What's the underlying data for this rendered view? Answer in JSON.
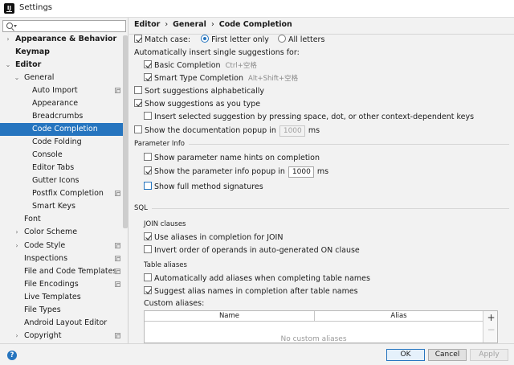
{
  "window": {
    "title": "Settings",
    "app_icon_glyph": "IJ"
  },
  "search": {
    "placeholder": "",
    "value": ""
  },
  "sidebar": {
    "items": [
      {
        "label": "Appearance & Behavior",
        "expander": "›"
      },
      {
        "label": "Keymap",
        "expander": ""
      },
      {
        "label": "Editor",
        "expander": "⌄"
      },
      {
        "label": "General",
        "expander": "⌄"
      },
      {
        "label": "Auto Import",
        "expander": ""
      },
      {
        "label": "Appearance",
        "expander": ""
      },
      {
        "label": "Breadcrumbs",
        "expander": ""
      },
      {
        "label": "Code Completion",
        "expander": ""
      },
      {
        "label": "Code Folding",
        "expander": ""
      },
      {
        "label": "Console",
        "expander": ""
      },
      {
        "label": "Editor Tabs",
        "expander": ""
      },
      {
        "label": "Gutter Icons",
        "expander": ""
      },
      {
        "label": "Postfix Completion",
        "expander": ""
      },
      {
        "label": "Smart Keys",
        "expander": ""
      },
      {
        "label": "Font",
        "expander": ""
      },
      {
        "label": "Color Scheme",
        "expander": "›"
      },
      {
        "label": "Code Style",
        "expander": "›"
      },
      {
        "label": "Inspections",
        "expander": ""
      },
      {
        "label": "File and Code Templates",
        "expander": ""
      },
      {
        "label": "File Encodings",
        "expander": ""
      },
      {
        "label": "Live Templates",
        "expander": ""
      },
      {
        "label": "File Types",
        "expander": ""
      },
      {
        "label": "Android Layout Editor",
        "expander": ""
      },
      {
        "label": "Copyright",
        "expander": "›"
      }
    ],
    "selected": "Code Completion"
  },
  "breadcrumb": {
    "part1": "Editor",
    "part2": "General",
    "part3": "Code Completion",
    "separator": "›"
  },
  "completion": {
    "match_case": "Match case:",
    "first_letter_only": "First letter only",
    "all_letters": "All letters",
    "auto_insert_title": "Automatically insert single suggestions for:",
    "basic_completion": "Basic Completion",
    "basic_shortcut": "Ctrl+空格",
    "smart_type_completion": "Smart Type Completion",
    "smart_shortcut": "Alt+Shift+空格",
    "sort_alpha": "Sort suggestions alphabetically",
    "show_as_you_type": "Show suggestions as you type",
    "insert_selected": "Insert selected suggestion by pressing space, dot, or other context-dependent keys",
    "doc_popup": "Show the documentation popup in",
    "doc_popup_value": "1000",
    "doc_popup_unit": "ms"
  },
  "parameter_info": {
    "title": "Parameter Info",
    "name_hints": "Show parameter name hints on completion",
    "info_popup": "Show the parameter info popup in",
    "info_popup_value": "1000",
    "info_popup_unit": "ms",
    "full_signatures": "Show full method signatures"
  },
  "sql": {
    "title": "SQL",
    "join_title": "JOIN clauses",
    "use_aliases": "Use aliases in completion for JOIN",
    "invert_order": "Invert order of operands in auto-generated ON clause",
    "table_aliases_title": "Table aliases",
    "auto_add": "Automatically add aliases when completing table names",
    "suggest_alias": "Suggest alias names in completion after table names",
    "custom_aliases": "Custom aliases:",
    "table": {
      "col_name": "Name",
      "col_alias": "Alias",
      "empty": "No custom aliases"
    },
    "add_glyph": "+",
    "remove_glyph": "−"
  },
  "buttons": {
    "ok": "OK",
    "cancel": "Cancel",
    "apply": "Apply",
    "help": "?"
  },
  "colors": {
    "accent": "#2675bf",
    "selected_bg": "#2675bf"
  }
}
